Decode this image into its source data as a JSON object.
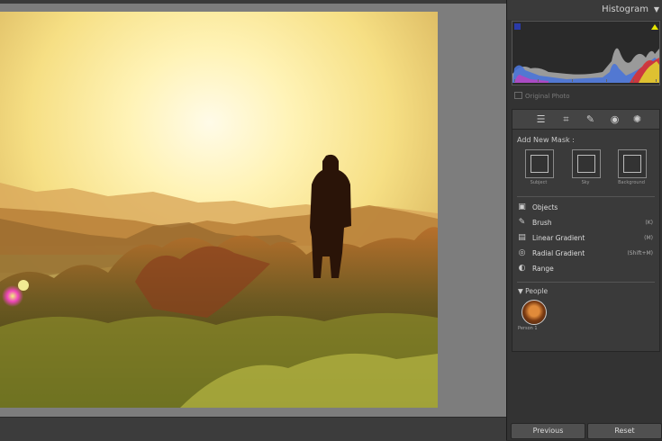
{
  "histogram": {
    "title": "Histogram",
    "collapse_icon": "triangle-down-icon",
    "original_photo_label": "Original Photo"
  },
  "tools": [
    "sliders-icon",
    "crop-icon",
    "healing-brush-icon",
    "red-eye-icon",
    "masking-icon"
  ],
  "masks": {
    "add_label": "Add New Mask :",
    "quick": [
      {
        "label": "Subject",
        "icon": "subject-icon"
      },
      {
        "label": "Sky",
        "icon": "sky-icon"
      },
      {
        "label": "Background",
        "icon": "background-icon"
      }
    ],
    "items": [
      {
        "label": "Objects",
        "shortcut": "",
        "icon": "objects-icon"
      },
      {
        "label": "Brush",
        "shortcut": "(K)",
        "icon": "brush-icon"
      },
      {
        "label": "Linear Gradient",
        "shortcut": "(M)",
        "icon": "linear-gradient-icon"
      },
      {
        "label": "Radial Gradient",
        "shortcut": "(Shift+M)",
        "icon": "radial-gradient-icon"
      },
      {
        "label": "Range",
        "shortcut": "",
        "icon": "range-icon"
      }
    ],
    "people_header": "People",
    "person_label": "Person 1"
  },
  "footer": {
    "previous_label": "Previous",
    "reset_label": "Reset"
  }
}
